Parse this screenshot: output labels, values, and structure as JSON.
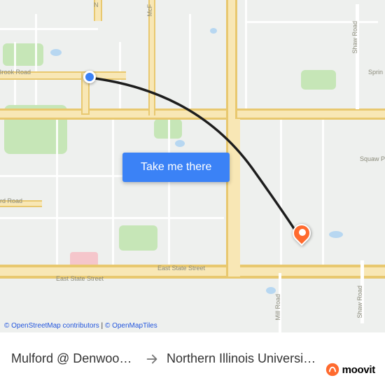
{
  "map": {
    "roads": {
      "spring_brook": "Spring Brook Road",
      "mulford": "Mulford Road",
      "east_state": "East State Street",
      "n": "N",
      "mcf": "McF",
      "shaw": "Shaw Road",
      "mill": "Mill Road",
      "sprin": "Sprin",
      "squaw": "Squaw Pra"
    },
    "attribution": {
      "osm": "© OpenStreetMap contributors",
      "separator": " | ",
      "tiles": "© OpenMapTiles"
    }
  },
  "cta_label": "Take me there",
  "footer": {
    "origin": "Mulford @ Denwood-S…",
    "destination": "Northern Illinois Universi…",
    "brand": "moovit"
  },
  "colors": {
    "primary": "#3b82f6",
    "accent": "#ff6a2e"
  }
}
